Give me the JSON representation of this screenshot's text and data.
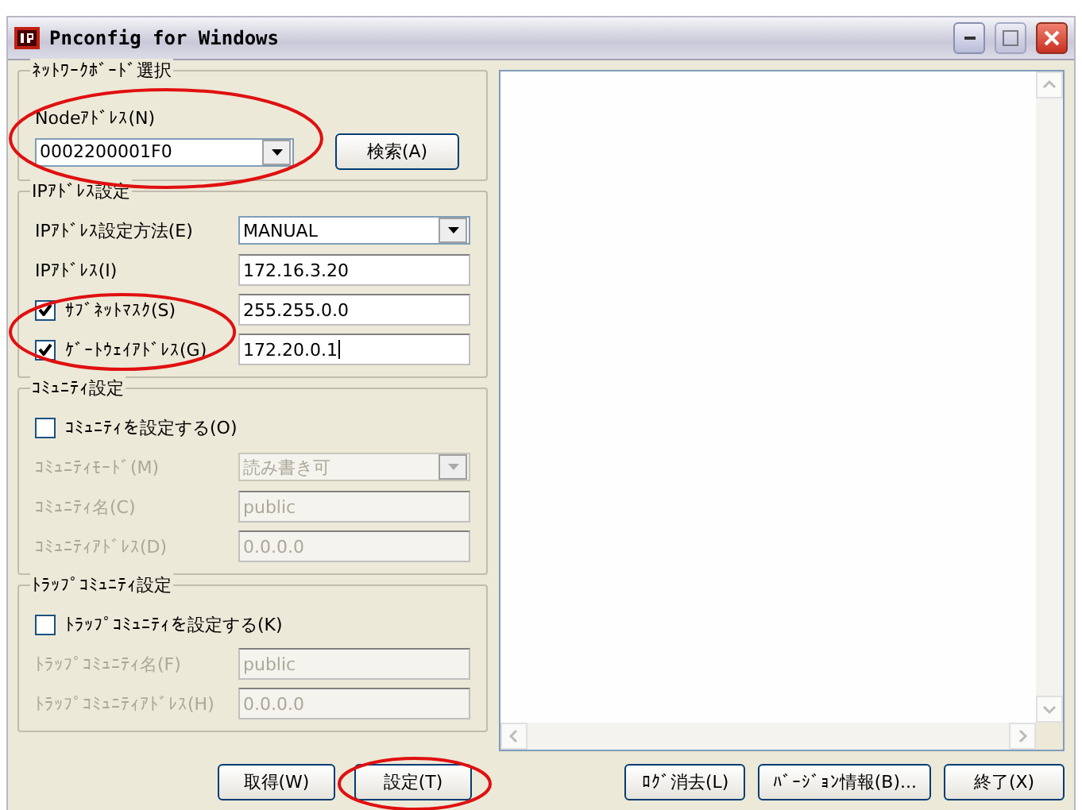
{
  "window": {
    "title": "Pnconfig for Windows"
  },
  "sections": [
    {
      "title": "ﾈｯﾄﾜｰｸﾎﾞｰﾄﾞ選択",
      "kind": "node",
      "label": "Nodeｱﾄﾞﾚｽ(N)",
      "value": "0002200001F0",
      "button": "検索(A)",
      "circled": true
    },
    {
      "title": "IPｱﾄﾞﾚｽ設定",
      "kind": "rows",
      "rows": [
        {
          "kind": "combo",
          "label": "IPｱﾄﾞﾚｽ設定方法(E)",
          "value": "MANUAL",
          "disabled": false,
          "circled": false
        },
        {
          "kind": "text",
          "label": "IPｱﾄﾞﾚｽ(I)",
          "value": "172.16.3.20",
          "disabled": false,
          "circled": false
        },
        {
          "kind": "check-text",
          "label": "ｻﾌﾞﾈｯﾄﾏｽｸ(S)",
          "value": "255.255.0.0",
          "checked": true,
          "disabled": false,
          "circled": true
        },
        {
          "kind": "check-text",
          "label": "ｹﾞｰﾄｳｪｲｱﾄﾞﾚｽ(G)",
          "value": "172.20.0.1",
          "checked": true,
          "disabled": false,
          "circled": true,
          "caret": true
        }
      ]
    },
    {
      "title": "ｺﾐｭﾆﾃｨ設定",
      "kind": "rows",
      "rows": [
        {
          "kind": "check",
          "label": "ｺﾐｭﾆﾃｨを設定する(O)",
          "checked": false,
          "disabled": false,
          "circled": false
        },
        {
          "kind": "combo",
          "label": "ｺﾐｭﾆﾃｨﾓｰﾄﾞ(M)",
          "value": "読み書き可",
          "disabled": true,
          "circled": false
        },
        {
          "kind": "text",
          "label": "ｺﾐｭﾆﾃｨ名(C)",
          "value": "public",
          "disabled": true,
          "circled": false
        },
        {
          "kind": "text",
          "label": "ｺﾐｭﾆﾃｨｱﾄﾞﾚｽ(D)",
          "value": "0.0.0.0",
          "disabled": true,
          "circled": false
        }
      ]
    },
    {
      "title": "ﾄﾗｯﾌﾟｺﾐｭﾆﾃｨ設定",
      "kind": "rows",
      "rows": [
        {
          "kind": "check",
          "label": "ﾄﾗｯﾌﾟｺﾐｭﾆﾃｨを設定する(K)",
          "checked": false,
          "disabled": false,
          "circled": false
        },
        {
          "kind": "text",
          "label": "ﾄﾗｯﾌﾟｺﾐｭﾆﾃｨ名(F)",
          "value": "public",
          "disabled": true,
          "circled": false
        },
        {
          "kind": "text",
          "label": "ﾄﾗｯﾌﾟｺﾐｭﾆﾃｨｱﾄﾞﾚｽ(H)",
          "value": "0.0.0.0",
          "disabled": true,
          "circled": false
        }
      ]
    }
  ],
  "left_buttons": [
    {
      "label": "取得(W)",
      "circled": false
    },
    {
      "label": "設定(T)",
      "circled": true
    }
  ],
  "right_buttons": [
    {
      "label": "ﾛｸﾞ消去(L)",
      "circled": false
    },
    {
      "label": "ﾊﾞｰｼﾞｮﾝ情報(B)...",
      "circled": false
    },
    {
      "label": "終了(X)",
      "circled": false
    }
  ]
}
